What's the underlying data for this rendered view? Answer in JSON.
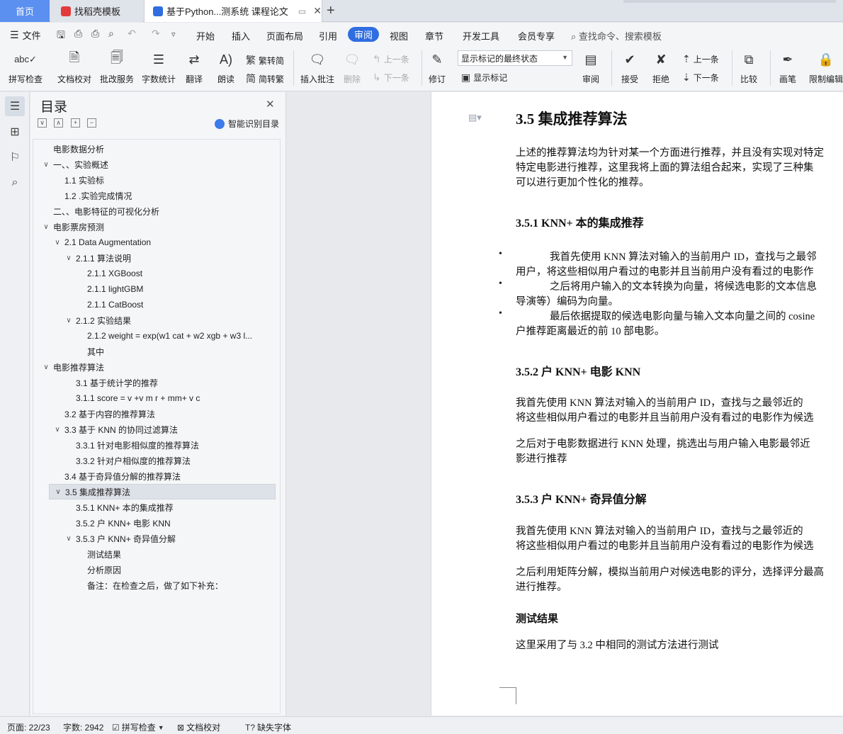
{
  "tabs": {
    "home": "首页",
    "tab1": "找稻壳模板",
    "tab2": "基于Python...测系统 课程论文",
    "add": "+"
  },
  "menu": {
    "file": "文件",
    "items": [
      "开始",
      "插入",
      "页面布局",
      "引用",
      "审阅",
      "视图",
      "章节",
      "开发工具",
      "会员专享"
    ],
    "active": "审阅",
    "search": "查找命令、搜索模板"
  },
  "ribbon": {
    "spell": "拼写检查",
    "doc_check": "文档校对",
    "revise_service": "批改服务",
    "word_count": "字数统计",
    "translate": "翻译",
    "read_aloud": "朗读",
    "to_trad": "繁转简",
    "to_simp": "简转繁",
    "insert_comment": "插入批注",
    "delete": "删除",
    "prev_comment": "上一条",
    "next_comment": "下一条",
    "revise": "修订",
    "markup_state": "显示标记的最终状态",
    "show_markup": "显示标记",
    "review": "审阅",
    "accept": "接受",
    "reject": "拒绝",
    "prev": "上一条",
    "next": "下一条",
    "compare": "比较",
    "pen": "画笔",
    "restrict": "限制编辑"
  },
  "toc": {
    "title": "目录",
    "smart": "智能识别目录",
    "items": [
      "电影数据分析",
      "一、、实验概述",
      "1.1 实验标",
      "1.2 .实验完成情况",
      "二、、电影特征的可视化分析",
      "电影票房预测",
      "2.1 Data Augmentation",
      "2.1.1 算法说明",
      "2.1.1 XGBoost",
      "2.1.1 lightGBM",
      "2.1.1 CatBoost",
      "2.1.2 实验结果",
      "2.1.2 weight = exp(w1 cat + w2 xgb + w3 l...",
      "其中",
      "电影推荐算法",
      "3.1 基于统计学的推荐",
      "3.1.1 score = v +v m r + mm+ v c",
      "3.2 基于内容的推荐算法",
      "3.3 基于 KNN 的协同过滤算法",
      "3.3.1 针对电影相似度的推荐算法",
      "3.3.2 针对户相似度的推荐算法",
      "3.4 基于奇异值分解的推荐算法",
      "3.5 集成推荐算法",
      "3.5.1 KNN+ 本的集成推荐",
      "3.5.2 户 KNN+ 电影 KNN",
      "3.5.3 户 KNN+ 奇异值分解",
      "测试结果",
      "分析原因",
      "备注：在检查之后，做了如下补充："
    ]
  },
  "doc": {
    "h_35": "3.5 集成推荐算法",
    "p1": [
      "上述的推荐算法均为针对某一个方面进行推荐，并且没有实现对特定",
      "特定电影进行推荐，这里我将上面的算法组合起来，实现了三种集",
      "可以进行更加个性化的推荐。"
    ],
    "h_351": "3.5.1 KNN+ 本的集成推荐",
    "b1": [
      "我首先使用 KNN 算法对输入的当前用户 ID，查找与之最邻",
      "用户，将这些相似用户看过的电影并且当前用户没有看过的电影作"
    ],
    "b2": [
      "之后将用户输入的文本转换为向量，将候选电影的文本信息",
      "导演等）编码为向量。"
    ],
    "b3": [
      "最后依据提取的候选电影向量与输入文本向量之间的 cosine",
      "户推荐距离最近的前 10 部电影。"
    ],
    "h_352": "3.5.2 户 KNN+ 电影 KNN",
    "p2": [
      "我首先使用 KNN 算法对输入的当前用户 ID，查找与之最邻近的",
      "将这些相似用户看过的电影并且当前用户没有看过的电影作为候选"
    ],
    "p3": [
      "之后对于电影数据进行 KNN 处理，挑选出与用户输入电影最邻近",
      "影进行推荐"
    ],
    "h_353": "3.5.3 户 KNN+ 奇异值分解",
    "p4": [
      "我首先使用 KNN 算法对输入的当前用户 ID，查找与之最邻近的",
      "将这些相似用户看过的电影并且当前用户没有看过的电影作为候选"
    ],
    "p5": [
      "之后利用矩阵分解，模拟当前用户对候选电影的评分，选择评分最高",
      "进行推荐。"
    ],
    "h_test": "测试结果",
    "p6": "这里采用了与 3.2 中相同的测试方法进行测试"
  },
  "status": {
    "page": "页面: 22/23",
    "words": "字数: 2942",
    "spell": "拼写检查",
    "doc_check": "文档校对",
    "missing_font": "缺失字体"
  }
}
